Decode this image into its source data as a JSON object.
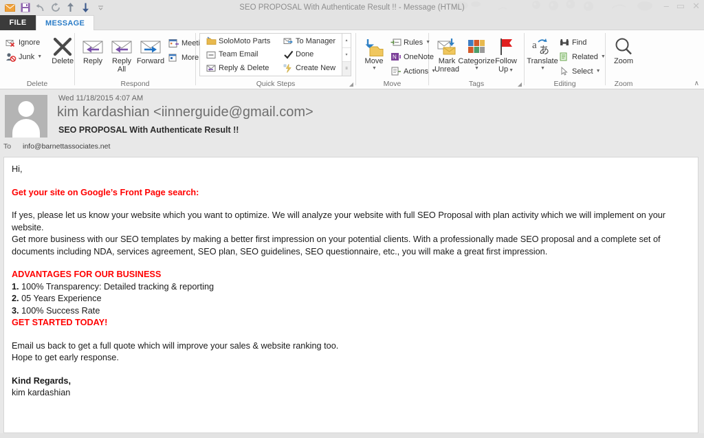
{
  "window": {
    "title": "SEO PROPOSAL With Authenticate Result !! - Message (HTML)",
    "minimize": "–",
    "maximize": "▭",
    "close": "✕"
  },
  "quick_access": [
    {
      "name": "envelope-icon",
      "tooltip": "Mail"
    },
    {
      "name": "save-icon",
      "tooltip": "Save"
    },
    {
      "name": "undo-icon",
      "tooltip": "Undo"
    },
    {
      "name": "redo-icon",
      "tooltip": "Redo"
    },
    {
      "name": "previous-item-icon",
      "tooltip": "Previous Item"
    },
    {
      "name": "next-item-icon",
      "tooltip": "Next Item"
    },
    {
      "name": "customize-qat-icon",
      "tooltip": "Customize Quick Access Toolbar"
    }
  ],
  "tabs": {
    "file": "FILE",
    "message": "MESSAGE"
  },
  "ribbon": {
    "collapse_icon": "∧",
    "groups": {
      "delete": {
        "label": "Delete",
        "ignore": "Ignore",
        "junk": "Junk",
        "delete": "Delete"
      },
      "respond": {
        "label": "Respond",
        "reply": "Reply",
        "reply_all_line1": "Reply",
        "reply_all_line2": "All",
        "forward": "Forward",
        "meeting": "Meeting",
        "more": "More"
      },
      "quick_steps": {
        "label": "Quick Steps",
        "items": [
          "SoloMoto Parts",
          "Team Email",
          "Reply & Delete",
          "To Manager",
          "Done",
          "Create New"
        ],
        "scroll_up": "▴",
        "scroll_down": "▾",
        "more": "≡"
      },
      "move": {
        "label": "Move",
        "move": "Move",
        "rules": "Rules",
        "onenote": "OneNote",
        "actions": "Actions"
      },
      "tags": {
        "label": "Tags",
        "mark_unread_line1": "Mark",
        "mark_unread_line2": "Unread",
        "categorize": "Categorize",
        "follow_up_line1": "Follow",
        "follow_up_line2": "Up"
      },
      "editing": {
        "label": "Editing",
        "translate": "Translate",
        "find": "Find",
        "related": "Related",
        "select": "Select"
      },
      "zoom": {
        "label": "Zoom",
        "zoom": "Zoom"
      }
    }
  },
  "message": {
    "date": "Wed 11/18/2015 4:07 AM",
    "from": "kim kardashian <iinnerguide@gmail.com>",
    "subject": "SEO PROPOSAL With Authenticate Result !!",
    "to_label": "To",
    "to_value": "info@barnettassociates.net"
  },
  "body": {
    "greeting": "Hi,",
    "headline": "Get your site on Google’s Front Page search:",
    "para1": "If yes, please let us know your website which you want to optimize. We will analyze your website with full SEO Proposal with plan activity which we will implement on your website.",
    "para2": "Get more business with our SEO templates by making a better first impression on your potential clients. With a professionally made SEO proposal and a complete set of documents including NDA, services agreement, SEO plan, SEO guidelines, SEO questionnaire, etc., you will make a great first impression.",
    "advantages_title": "ADVANTAGES FOR OUR BUSINESS",
    "advantages": [
      {
        "num": "1.",
        "text": "100% Transparency: Detailed tracking & reporting"
      },
      {
        "num": "2.",
        "text": "05 Years Experience"
      },
      {
        "num": "3.",
        "text": "100% Success Rate"
      }
    ],
    "cta": "GET STARTED TODAY!",
    "closing1": "Email us back to get a full quote which will improve your sales & website ranking too.",
    "closing2": "Hope to get early response.",
    "signoff": "Kind Regards,",
    "signature": "kim kardashian"
  },
  "colors": {
    "accent_red": "#ff0000",
    "tab_active_text": "#2a7cc7",
    "file_tab_bg": "#3b3b3b",
    "chrome_bg": "#e3e3e3"
  }
}
